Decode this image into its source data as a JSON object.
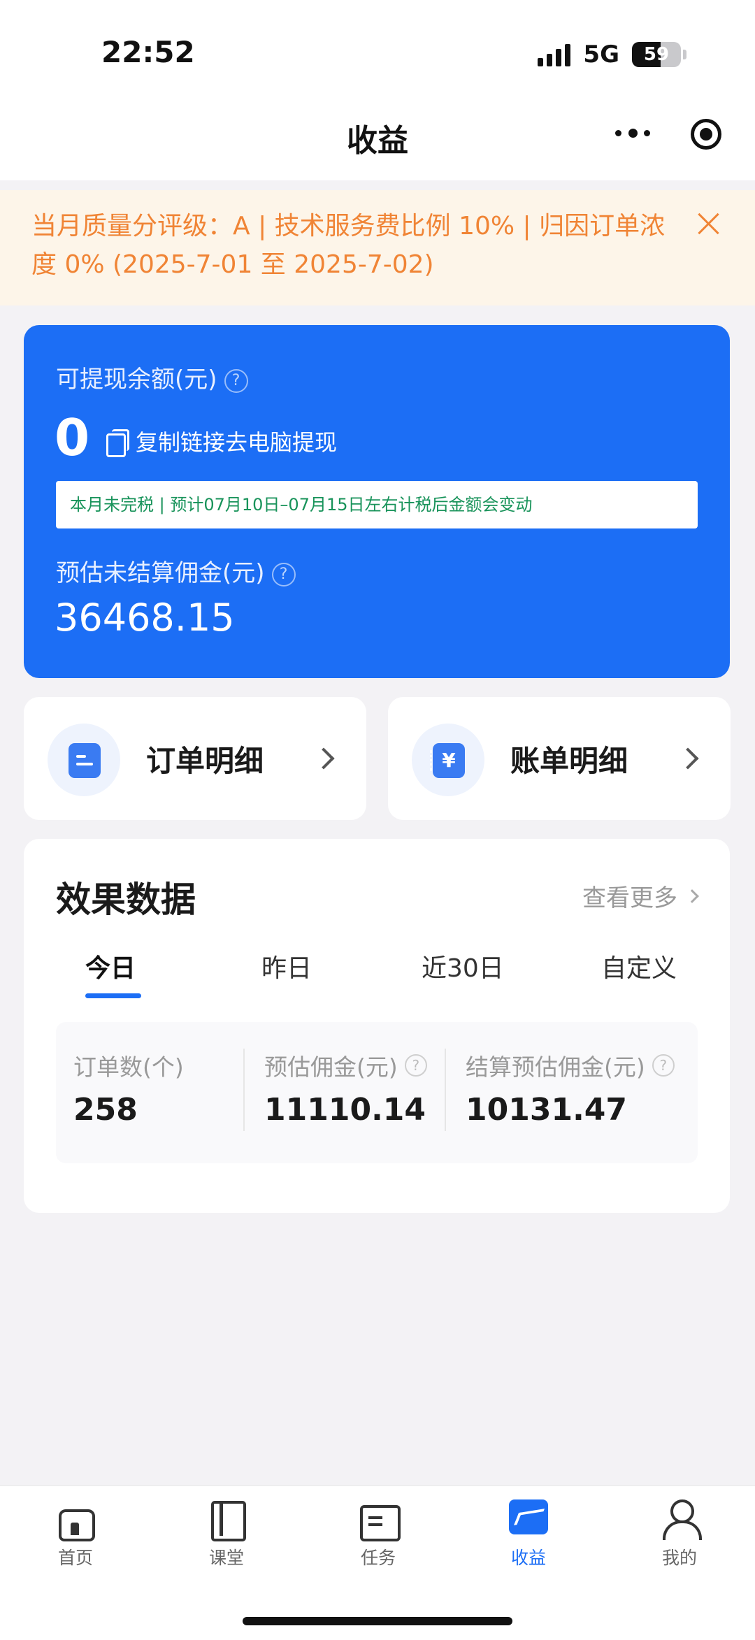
{
  "status_bar": {
    "time": "22:52",
    "network": "5G",
    "battery": "59",
    "battery_level": 0.59
  },
  "nav": {
    "title": "收益",
    "more_icon": "more-dots-icon",
    "target_icon": "target-icon"
  },
  "notice": {
    "text": "当月质量分评级：A | 技术服务费比例 10% | 归因订单浓度 0% (2025-7-01 至 2025-7-02)",
    "close_icon": "close-icon",
    "color": "#f08435"
  },
  "balance": {
    "label": "可提现余额(元)",
    "value": "0",
    "copy_link": "复制链接去电脑提现",
    "tax_note": "本月未完税 | 预计07月10日–07月15日左右计税后金额会变动",
    "estimated_label": "预估未结算佣金(元)",
    "estimated_value": "36468.15",
    "card_color": "#1c6ef5"
  },
  "quick_links": [
    {
      "label": "订单明细",
      "icon": "order-list-icon"
    },
    {
      "label": "账单明细",
      "icon": "bill-icon"
    }
  ],
  "effect": {
    "title": "效果数据",
    "see_more": "查看更多",
    "tabs": [
      "今日",
      "昨日",
      "近30日",
      "自定义"
    ],
    "active_tab": "今日",
    "stats": [
      {
        "label": "订单数(个)",
        "value": "258"
      },
      {
        "label": "预估佣金(元)",
        "value": "11110.14"
      },
      {
        "label": "结算预估佣金(元)",
        "value": "10131.47"
      }
    ]
  },
  "tabbar": {
    "items": [
      {
        "label": "首页",
        "icon": "home-icon"
      },
      {
        "label": "课堂",
        "icon": "book-icon"
      },
      {
        "label": "任务",
        "icon": "task-icon"
      },
      {
        "label": "收益",
        "icon": "earnings-icon"
      },
      {
        "label": "我的",
        "icon": "user-icon"
      }
    ],
    "active": "收益",
    "accent": "#1c6ef5"
  }
}
